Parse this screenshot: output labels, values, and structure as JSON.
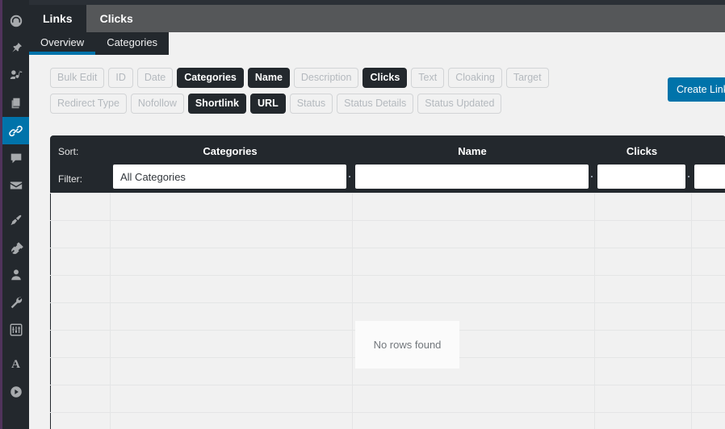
{
  "colors": {
    "accent_blue": "#0073aa",
    "dark": "#23282d",
    "tabbar_gray": "#555759",
    "arrow_magenta": "#d1266c",
    "sidebar_border": "#50335b",
    "page_bg": "#f1f1f1"
  },
  "sidebar": {
    "items": [
      {
        "name": "dashboard",
        "icon": "dashboard-icon",
        "active": false
      },
      {
        "name": "posts",
        "icon": "pin-icon",
        "active": false
      },
      {
        "name": "media",
        "icon": "media-icon",
        "active": false
      },
      {
        "name": "pages",
        "icon": "pages-icon",
        "active": false
      },
      {
        "name": "links",
        "icon": "link-icon",
        "active": true
      },
      {
        "name": "comments",
        "icon": "comment-icon",
        "active": false
      },
      {
        "name": "mail",
        "icon": "mail-icon",
        "active": false
      },
      {
        "name": "appearance",
        "icon": "brush-icon",
        "active": false
      },
      {
        "name": "plugins",
        "icon": "plug-icon",
        "active": false
      },
      {
        "name": "users",
        "icon": "user-icon",
        "active": false
      },
      {
        "name": "tools",
        "icon": "wrench-icon",
        "active": false
      },
      {
        "name": "settings",
        "icon": "sliders-icon",
        "active": false
      },
      {
        "name": "typography",
        "icon": "letter-a-icon",
        "active": false
      },
      {
        "name": "media-player",
        "icon": "play-circle-icon",
        "active": false
      }
    ]
  },
  "tabs": {
    "items": [
      {
        "label": "Links",
        "active": true
      },
      {
        "label": "Clicks",
        "active": false
      }
    ]
  },
  "subtabs": {
    "items": [
      {
        "label": "Overview",
        "active": true
      },
      {
        "label": "Categories",
        "active": false
      }
    ]
  },
  "column_toggles": {
    "items": [
      {
        "label": "Bulk Edit",
        "on": false
      },
      {
        "label": "ID",
        "on": false
      },
      {
        "label": "Date",
        "on": false
      },
      {
        "label": "Categories",
        "on": true
      },
      {
        "label": "Name",
        "on": true
      },
      {
        "label": "Description",
        "on": false
      },
      {
        "label": "Clicks",
        "on": true
      },
      {
        "label": "Text",
        "on": false
      },
      {
        "label": "Cloaking",
        "on": false
      },
      {
        "label": "Target",
        "on": false
      },
      {
        "label": "Redirect Type",
        "on": false
      },
      {
        "label": "Nofollow",
        "on": false
      },
      {
        "label": "Shortlink",
        "on": true
      },
      {
        "label": "URL",
        "on": true
      },
      {
        "label": "Status",
        "on": false
      },
      {
        "label": "Status Details",
        "on": false
      },
      {
        "label": "Status Updated",
        "on": false
      }
    ]
  },
  "toolbar": {
    "create_link_label": "Create Link"
  },
  "table": {
    "sort_label": "Sort:",
    "filter_label": "Filter:",
    "columns": [
      {
        "header": "Categories",
        "filter_value": "All Categories",
        "filter_placeholder": ""
      },
      {
        "header": "Name",
        "filter_value": "",
        "filter_placeholder": ""
      },
      {
        "header": "Clicks",
        "filter_value": "",
        "filter_placeholder": ""
      },
      {
        "header": "",
        "filter_value": "",
        "filter_placeholder": ""
      }
    ],
    "empty_message": "No rows found"
  }
}
